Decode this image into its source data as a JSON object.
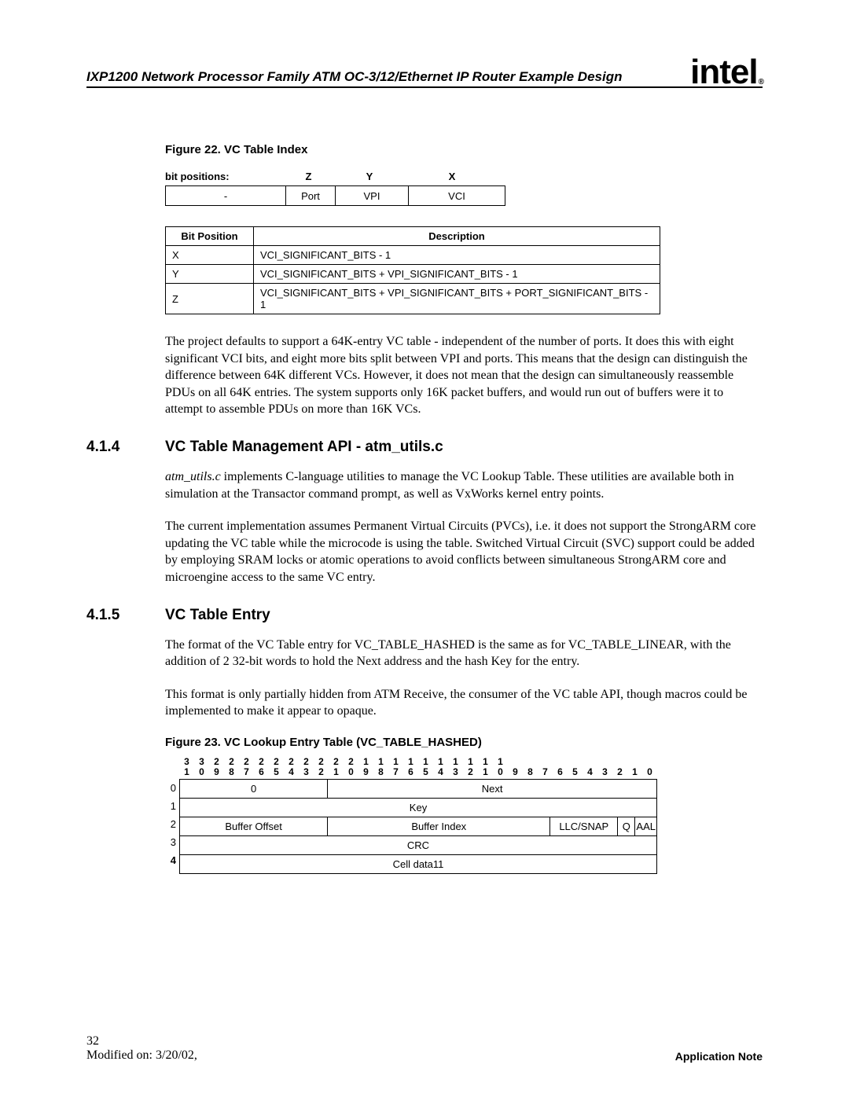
{
  "header": {
    "doc_title": "IXP1200 Network Processor Family ATM OC-3/12/Ethernet IP Router Example Design",
    "logo_text": "intel",
    "logo_reg": "®"
  },
  "figure22": {
    "caption": "Figure 22. VC Table Index",
    "bit_positions_label": "bit positions:",
    "z": "Z",
    "y": "Y",
    "x": "X",
    "port_row": {
      "dash": "-",
      "c1": "Port",
      "c2": "VPI",
      "c3": "VCI"
    },
    "desc_table": {
      "h1": "Bit Position",
      "h2": "Description",
      "rows": [
        {
          "pos": "X",
          "desc": "VCI_SIGNIFICANT_BITS - 1"
        },
        {
          "pos": "Y",
          "desc": "VCI_SIGNIFICANT_BITS + VPI_SIGNIFICANT_BITS - 1"
        },
        {
          "pos": "Z",
          "desc": "VCI_SIGNIFICANT_BITS + VPI_SIGNIFICANT_BITS + PORT_SIGNIFICANT_BITS - 1"
        }
      ]
    }
  },
  "para1": "The project defaults to support a 64K-entry VC table - independent of the number of ports. It does this with eight significant VCI bits, and eight more bits split between VPI and ports. This means that the design can distinguish the difference between 64K different VCs. However, it does not mean that the design can simultaneously reassemble PDUs on all 64K entries. The system supports only 16K packet buffers, and would run out of buffers were it to attempt to assemble PDUs on more than 16K VCs.",
  "section414": {
    "num": "4.1.4",
    "title": "VC Table Management API - atm_utils.c",
    "para_a_prefix": "atm_utils.c",
    "para_a_rest": " implements C-language utilities to manage the VC Lookup Table. These utilities are available both in simulation at the Transactor command prompt, as well as VxWorks kernel entry points.",
    "para_b": "The current implementation assumes Permanent Virtual Circuits (PVCs), i.e. it does not support the StrongARM core updating the VC table while the microcode is using the table. Switched Virtual Circuit (SVC) support could be added by employing SRAM locks or atomic operations to avoid conflicts between simultaneous StrongARM core and microengine access to the same VC entry."
  },
  "section415": {
    "num": "4.1.5",
    "title": "VC Table Entry",
    "para_a": "The format of the VC Table entry for VC_TABLE_HASHED is the same as for VC_TABLE_LINEAR, with the addition of 2 32-bit words to hold the Next address and the hash Key for the entry.",
    "para_b": "This format is only partially hidden from ATM Receive, the consumer of the VC table API, though macros could be implemented to make it appear to opaque."
  },
  "figure23": {
    "caption": "Figure 23. VC Lookup Entry Table (VC_TABLE_HASHED)",
    "bits_top": [
      "3",
      "3",
      "2",
      "2",
      "2",
      "2",
      "2",
      "2",
      "2",
      "2",
      "2",
      "2",
      "1",
      "1",
      "1",
      "1",
      "1",
      "1",
      "1",
      "1",
      "1",
      "1",
      "",
      "",
      "",
      "",
      "",
      "",
      "",
      "",
      "",
      ""
    ],
    "bits_bottom": [
      "1",
      "0",
      "9",
      "8",
      "7",
      "6",
      "5",
      "4",
      "3",
      "2",
      "1",
      "0",
      "9",
      "8",
      "7",
      "6",
      "5",
      "4",
      "3",
      "2",
      "1",
      "0",
      "9",
      "8",
      "7",
      "6",
      "5",
      "4",
      "3",
      "2",
      "1",
      "0"
    ],
    "row_labels": [
      "0",
      "1",
      "2",
      "3",
      "4"
    ],
    "row0": {
      "zero": "0",
      "next": "Next"
    },
    "row1": {
      "key": "Key"
    },
    "row2": {
      "bo": "Buffer Offset",
      "bi": "Buffer Index",
      "llc": "LLC/SNAP",
      "q": "Q",
      "aal": "AAL"
    },
    "row3": {
      "crc": "CRC"
    },
    "row4": {
      "cd": "Cell data11"
    }
  },
  "footer": {
    "page_num": "32",
    "modified": "Modified on: 3/20/02,",
    "app_note": "Application Note"
  }
}
